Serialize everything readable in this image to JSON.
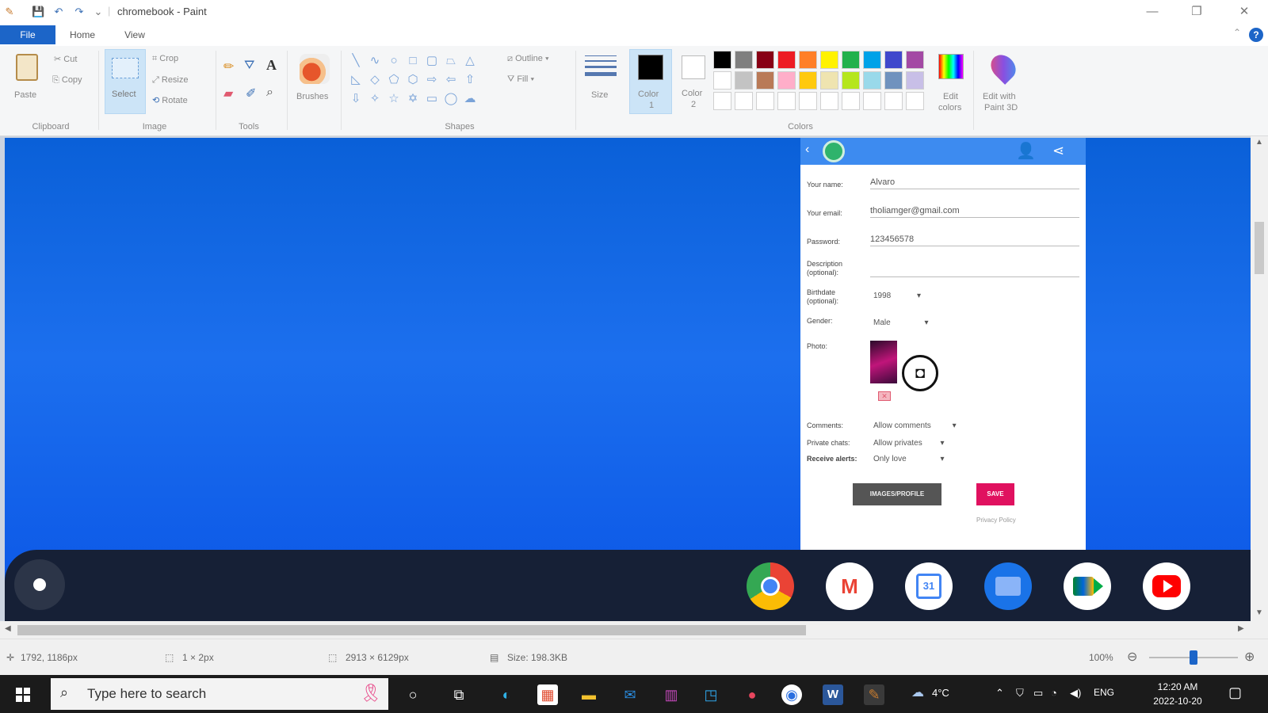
{
  "window": {
    "title": "chromebook - Paint",
    "quick_access": {
      "save": "💾",
      "undo": "↶",
      "redo": "↷",
      "more": "⌄"
    },
    "buttons": {
      "minimize": "—",
      "maximize": "❐",
      "close": "✕"
    }
  },
  "tabs": {
    "file": "File",
    "home": "Home",
    "view": "View",
    "help": "?",
    "collapse": "⌃"
  },
  "ribbon": {
    "clipboard": {
      "paste": "Paste",
      "cut": "Cut",
      "copy": "Copy",
      "label": "Clipboard"
    },
    "image": {
      "select": "Select",
      "crop": "Crop",
      "resize": "Resize",
      "rotate": "Rotate",
      "label": "Image"
    },
    "tools": {
      "label": "Tools",
      "text": "A"
    },
    "brushes": {
      "label": "Brushes"
    },
    "shapes": {
      "outline": "Outline",
      "fill": "Fill",
      "label": "Shapes"
    },
    "size": {
      "label": "Size"
    },
    "color1": {
      "label": "Color",
      "sub": "1",
      "hex": "#000000"
    },
    "color2": {
      "label": "Color",
      "sub": "2",
      "hex": "#ffffff"
    },
    "colors": {
      "label": "Colors",
      "row1": [
        "#000000",
        "#7f7f7f",
        "#880015",
        "#ed1c24",
        "#ff7f27",
        "#fff200",
        "#22b14c",
        "#00a2e8",
        "#3f48cc",
        "#a349a4"
      ],
      "row2": [
        "#ffffff",
        "#c3c3c3",
        "#b97a57",
        "#ffaec9",
        "#ffc90e",
        "#efe4b0",
        "#b5e61d",
        "#99d9ea",
        "#7092be",
        "#c8bfe7"
      ],
      "row3": [
        "#ffffff",
        "#ffffff",
        "#ffffff",
        "#ffffff",
        "#ffffff",
        "#ffffff",
        "#ffffff",
        "#ffffff",
        "#ffffff",
        "#ffffff"
      ]
    },
    "edit_colors": {
      "line1": "Edit",
      "line2": "colors"
    },
    "paint3d": {
      "line1": "Edit with",
      "line2": "Paint 3D"
    }
  },
  "app": {
    "name_label": "Your name:",
    "name_value": "Alvaro",
    "email_label": "Your email:",
    "email_value": "tholiamger@gmail.com",
    "password_label": "Password:",
    "password_value": "123456578",
    "description_label": "Description (optional):",
    "birthdate_label": "Birthdate (optional):",
    "birthdate_value": "1998",
    "gender_label": "Gender:",
    "gender_value": "Male",
    "photo_label": "Photo:",
    "comments_label": "Comments:",
    "comments_value": "Allow comments",
    "private_label": "Private chats:",
    "private_value": "Allow privates",
    "alerts_label": "Receive alerts:",
    "alerts_value": "Only love",
    "images_button": "IMAGES/PROFILE",
    "save_button": "SAVE",
    "privacy_link": "Privacy Policy"
  },
  "shelf": {
    "apps": [
      "Chrome",
      "Gmail",
      "Calendar",
      "Files",
      "Meet",
      "YouTube"
    ],
    "calendar_day": "31"
  },
  "status": {
    "cursor": "1792, 1186px",
    "selection": "1 × 2px",
    "dimensions": "2913 × 6129px",
    "size": "Size: 198.3KB",
    "zoom": "100%",
    "zoom_level": 0.5
  },
  "taskbar": {
    "search_placeholder": "Type here to search",
    "weather": "4°C",
    "lang": "ENG",
    "time": "12:20 AM",
    "date": "2022-10-20"
  }
}
